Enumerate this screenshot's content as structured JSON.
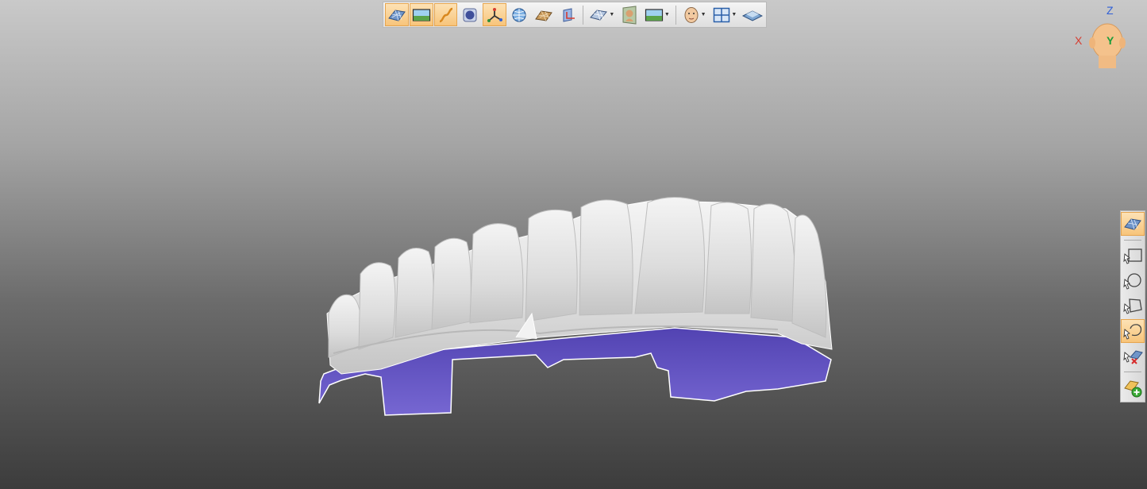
{
  "top_toolbar": {
    "tools": [
      {
        "icon": "mesh-model-icon",
        "highlighted": true
      },
      {
        "icon": "landscape-texture-icon",
        "highlighted": true
      },
      {
        "icon": "curve-icon",
        "highlighted": true
      },
      {
        "icon": "sphere-icon",
        "highlighted": false
      },
      {
        "icon": "axes-icon",
        "highlighted": true
      },
      {
        "icon": "globe-icon",
        "highlighted": false
      },
      {
        "icon": "mesh-grid-icon",
        "highlighted": false
      },
      {
        "icon": "section-plane-icon",
        "highlighted": false
      },
      {
        "icon": "render-mode-icon",
        "highlighted": false,
        "dropdown": true
      },
      {
        "icon": "head-view-icon",
        "highlighted": false
      },
      {
        "icon": "background-image-icon",
        "highlighted": false,
        "dropdown": true
      },
      {
        "icon": "face-icon",
        "highlighted": false,
        "dropdown": true
      },
      {
        "icon": "layout-split-icon",
        "highlighted": false,
        "dropdown": true
      },
      {
        "icon": "layer-plane-icon",
        "highlighted": false
      }
    ]
  },
  "right_toolbar": {
    "tools": [
      {
        "icon": "mesh-select-icon",
        "highlighted": true
      },
      {
        "icon": "rectangle-select-icon",
        "highlighted": false
      },
      {
        "icon": "circle-select-icon",
        "highlighted": false
      },
      {
        "icon": "polygon-select-icon",
        "highlighted": false
      },
      {
        "icon": "lasso-select-icon",
        "highlighted": true
      },
      {
        "icon": "clear-selection-icon",
        "highlighted": false
      },
      {
        "icon": "add-object-icon",
        "highlighted": false
      }
    ]
  },
  "axis_gizmo": {
    "z": "Z",
    "x": "X",
    "y": "Y"
  },
  "colors": {
    "accent": "#f7c47a",
    "model": "#e7e7e7",
    "cut_surface": "#6a5bc4"
  }
}
